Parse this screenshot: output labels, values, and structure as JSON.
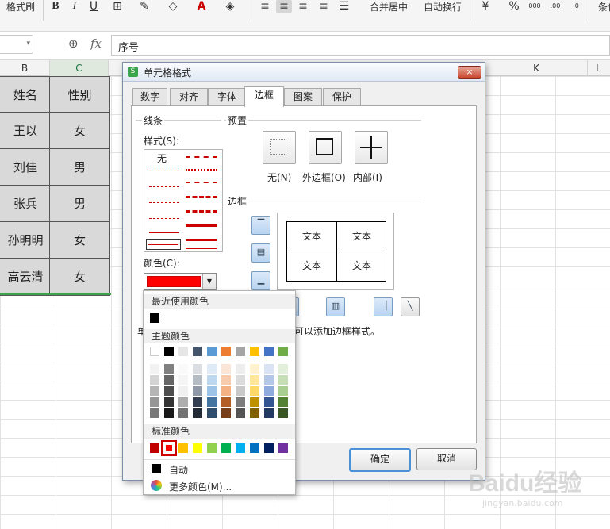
{
  "ribbon": {
    "format_painter": "格式刷",
    "merge_center": "合并居中",
    "wrap_text": "自动换行",
    "cond": "条件"
  },
  "formula_bar": {
    "fx": "fx",
    "content": "序号"
  },
  "columns": [
    "B",
    "C",
    "K",
    "L"
  ],
  "table": {
    "header": [
      "姓名",
      "性别"
    ],
    "rows": [
      [
        "王以",
        "女"
      ],
      [
        "刘佳",
        "男"
      ],
      [
        "张兵",
        "男"
      ],
      [
        "孙明明",
        "女"
      ],
      [
        "高云清",
        "女"
      ]
    ]
  },
  "dialog": {
    "title": "单元格格式",
    "close": "×",
    "tabs": [
      "数字",
      "对齐",
      "字体",
      "边框",
      "图案",
      "保护"
    ],
    "active_tab": "边框",
    "line_group": "线条",
    "style_label": "样式(S):",
    "style_none": "无",
    "color_label": "颜色(C):",
    "selected_color": "#ff0000",
    "preset_group": "预置",
    "presets": [
      "无(N)",
      "外边框(O)",
      "内部(I)"
    ],
    "border_group": "边框",
    "preview_text": "文本",
    "hint_left": "单",
    "hint_right": "可以添加边框样式。",
    "ok": "确定",
    "cancel": "取消"
  },
  "color_menu": {
    "recent_title": "最近使用颜色",
    "recent": [
      "#000000"
    ],
    "theme_title": "主题颜色",
    "theme_top": [
      "#ffffff",
      "#000000",
      "#e7e6e6",
      "#44546a",
      "#5b9bd5",
      "#ed7d31",
      "#a5a5a5",
      "#ffc000",
      "#4472c4",
      "#70ad47"
    ],
    "standard_title": "标准颜色",
    "standard": [
      "#c00000",
      "#ff0000",
      "#ffc000",
      "#ffff00",
      "#92d050",
      "#00b050",
      "#00b0f0",
      "#0070c0",
      "#002060",
      "#7030a0"
    ],
    "selected_standard": "#ff0000",
    "auto": "自动",
    "more": "更多颜色(M)..."
  },
  "watermark": {
    "logo": "Baidu经验",
    "url": "jingyan.baidu.com"
  }
}
